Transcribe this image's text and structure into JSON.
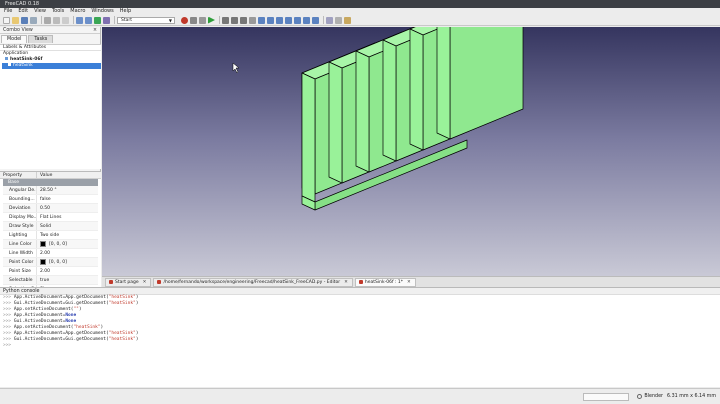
{
  "window": {
    "title": "FreeCAD 0.18"
  },
  "menu": [
    "File",
    "Edit",
    "View",
    "Tools",
    "Macro",
    "Windows",
    "Help"
  ],
  "toolbar": {
    "workbench": "Start",
    "colors": {
      "record": "#c0392b",
      "run": "#2e9e3a"
    }
  },
  "combo": {
    "title": "Combo View",
    "tabs": [
      "Model",
      "Tasks"
    ],
    "tree_header": "Labels & Attributes",
    "app_label": "Application",
    "document": "heatSink-06f",
    "object": "heatSink"
  },
  "properties": {
    "col_property": "Property",
    "col_value": "Value",
    "group": "Base",
    "rows": [
      {
        "key": "Angular De...",
        "value": "28.50 °"
      },
      {
        "key": "Bounding...",
        "value": "false"
      },
      {
        "key": "Deviation",
        "value": "0.50"
      },
      {
        "key": "Display Mo...",
        "value": "Flat Lines"
      },
      {
        "key": "Draw Style",
        "value": "Solid"
      },
      {
        "key": "Lighting",
        "value": "Two side"
      },
      {
        "key": "Line Color",
        "value": "[0, 0, 0]",
        "swatch": "#000000"
      },
      {
        "key": "Line Width",
        "value": "2.00"
      },
      {
        "key": "Point Color",
        "value": "[0, 0, 0]",
        "swatch": "#000000"
      },
      {
        "key": "Point Size",
        "value": "2.00"
      },
      {
        "key": "Selectable",
        "value": "true"
      },
      {
        "key": "Selection S...",
        "value": "Shape"
      },
      {
        "key": "Shape Color",
        "value": "[204, 204, 204]",
        "swatch": "#cccccc"
      }
    ],
    "bottom_tabs": [
      "View",
      "Data"
    ]
  },
  "doc_tabs": [
    {
      "label": "Start page"
    },
    {
      "label": "/home/fernando/workspace/engineering/Freecad/heatSink_FreeCAD.py - Editor"
    },
    {
      "label": "heatSink-06f : 1*"
    }
  ],
  "console": {
    "title": "Python console",
    "lines": [
      {
        "pre": "App.ActiveDocument=App.getDocument(",
        "str": "\"heatSink\"",
        "post": ")"
      },
      {
        "pre": "Gui.ActiveDocument=Gui.getDocument(",
        "str": "\"heatSink\"",
        "post": ")"
      },
      {
        "pre": "App.setActiveDocument(",
        "str": "\"\"",
        "post": ")"
      },
      {
        "pre": "App.ActiveDocument=",
        "kw": "None"
      },
      {
        "pre": "Gui.ActiveDocument=",
        "kw": "None"
      },
      {
        "pre": "App.setActiveDocument(",
        "str": "\"heatSink\"",
        "post": ")"
      },
      {
        "pre": "App.ActiveDocument=App.getDocument(",
        "str": "\"heatSink\"",
        "post": ")"
      },
      {
        "pre": "Gui.ActiveDocument=Gui.getDocument(",
        "str": "\"heatSink\"",
        "post": ")"
      },
      {
        "pre": ""
      }
    ]
  },
  "status": {
    "nav_style": "Blender",
    "dimensions": "6.31 mm x 6.14 mm"
  },
  "model": {
    "fill": "#99f299",
    "edge": "#000000"
  }
}
